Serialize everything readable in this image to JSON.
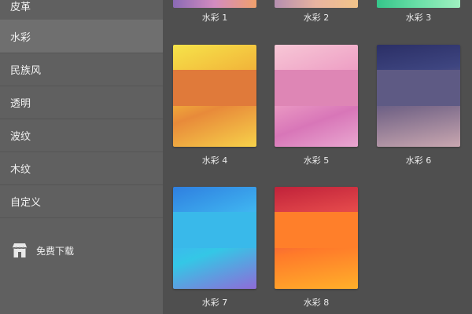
{
  "sidebar": {
    "items": [
      {
        "label": "皮革",
        "selected": false
      },
      {
        "label": "水彩",
        "selected": true
      },
      {
        "label": "民族风",
        "selected": false
      },
      {
        "label": "透明",
        "selected": false
      },
      {
        "label": "波纹",
        "selected": false
      },
      {
        "label": "木纹",
        "selected": false
      },
      {
        "label": "自定义",
        "selected": false
      }
    ],
    "download": {
      "label": "免费下载",
      "icon": "store-icon"
    }
  },
  "grid": {
    "items": [
      {
        "label": "水彩 1",
        "band_color": "#b07dc0"
      },
      {
        "label": "水彩 2",
        "band_color": "#d7a9a0"
      },
      {
        "label": "水彩 3",
        "band_color": "#53d59b"
      },
      {
        "label": "水彩 4",
        "band_color": "#e07a3a"
      },
      {
        "label": "水彩 5",
        "band_color": "#de86b5"
      },
      {
        "label": "水彩 6",
        "band_color": "#5e5a84"
      },
      {
        "label": "水彩 7",
        "band_color": "#39b9ea"
      },
      {
        "label": "水彩 8",
        "band_color": "#ff7f2a"
      }
    ]
  }
}
